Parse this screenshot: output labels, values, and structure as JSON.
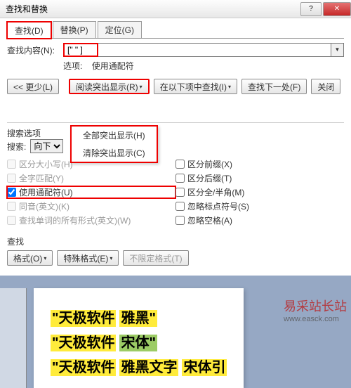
{
  "title": "查找和替换",
  "tabs": {
    "find": "查找(D)",
    "replace": "替换(P)",
    "goto": "定位(G)"
  },
  "find": {
    "label": "查找内容(N):",
    "value": "[\" \" ]",
    "options_label": "选项:",
    "options_value": "使用通配符"
  },
  "buttons": {
    "less": "<< 更少(L)",
    "highlight": "阅读突出显示(R)",
    "findin": "在以下项中查找(I)",
    "findnext": "查找下一处(F)",
    "cancel": "关闭",
    "format": "格式(O)",
    "special": "特殊格式(E)",
    "noformat": "不限定格式(T)"
  },
  "menu": {
    "all": "全部突出显示(H)",
    "clear": "清除突出显示(C)"
  },
  "opts": {
    "header": "搜索选项",
    "search_label": "搜索:",
    "direction": "向下",
    "matchcase": "区分大小写(H)",
    "wholeword": "全字匹配(Y)",
    "wildcards": "使用通配符(U)",
    "soundslike": "同音(英文)(K)",
    "wordforms": "查找单词的所有形式(英文)(W)",
    "prefix": "区分前缀(X)",
    "suffix": "区分后缀(T)",
    "fullhalf": "区分全/半角(M)",
    "ignorepunct": "忽略标点符号(S)",
    "ignorespace": "忽略空格(A)"
  },
  "bottom_label": "查找",
  "doc": {
    "l1a": "\"天极软件",
    "l1b": "雅黑\"",
    "l2a": "\"天极软件",
    "l2b": "宋体\"",
    "l3a": "\"天极软件",
    "l3b": "雅黑文字",
    "l3c": "宋体引"
  },
  "wm": {
    "text": "易采站长站",
    "url": "www.easck.com"
  }
}
